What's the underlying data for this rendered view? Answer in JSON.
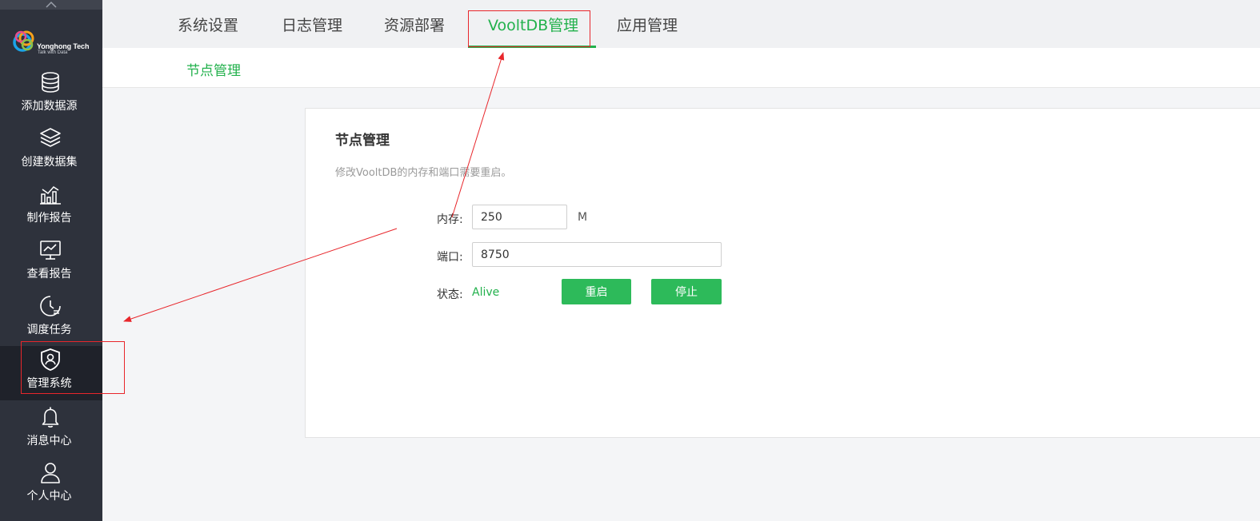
{
  "sidebar": {
    "logo": {
      "name": "Yonghong Tech",
      "tagline": "Talk with Data"
    },
    "items": [
      {
        "label": "添加数据源",
        "icon": "database-icon"
      },
      {
        "label": "创建数据集",
        "icon": "layers-icon"
      },
      {
        "label": "制作报告",
        "icon": "bar-chart-icon"
      },
      {
        "label": "查看报告",
        "icon": "monitor-chart-icon"
      },
      {
        "label": "调度任务",
        "icon": "clock-schedule-icon"
      },
      {
        "label": "管理系统",
        "icon": "shield-user-icon",
        "active": true
      },
      {
        "label": "消息中心",
        "icon": "bell-icon"
      },
      {
        "label": "个人中心",
        "icon": "user-icon"
      }
    ]
  },
  "tabs": [
    {
      "label": "系统设置"
    },
    {
      "label": "日志管理"
    },
    {
      "label": "资源部署"
    },
    {
      "label": "VooltDB管理",
      "active": true
    },
    {
      "label": "应用管理"
    }
  ],
  "subtabs": [
    {
      "label": "节点管理",
      "active": true
    }
  ],
  "panel": {
    "title": "节点管理",
    "description": "修改VooltDB的内存和端口需要重启。",
    "memory": {
      "label": "内存:",
      "value": "250",
      "unit": "M"
    },
    "port": {
      "label": "端口:",
      "value": "8750"
    },
    "status": {
      "label": "状态:",
      "value": "Alive"
    },
    "restart_label": "重启",
    "stop_label": "停止"
  },
  "colors": {
    "accent": "#22b14c",
    "sidebar_bg": "#2e323c",
    "annotation": "#e8262b"
  }
}
